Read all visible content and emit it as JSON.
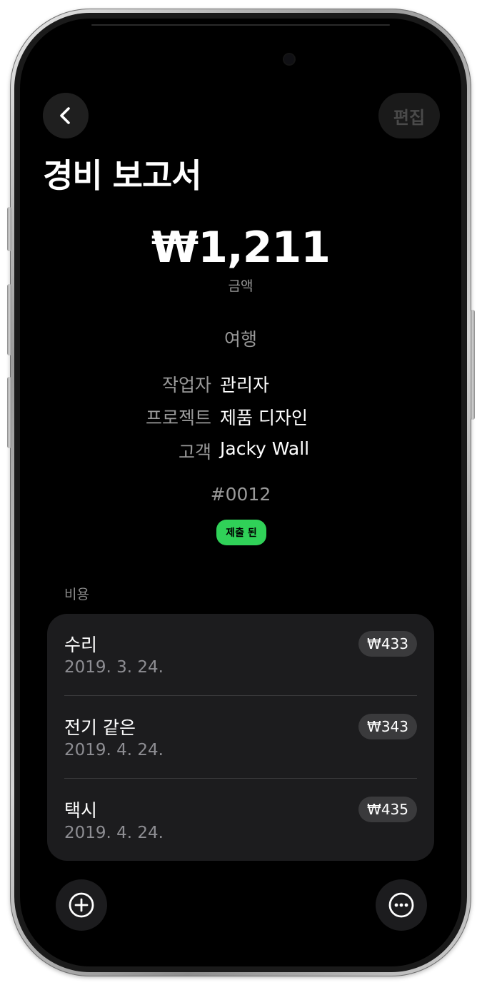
{
  "nav": {
    "back_icon": "chevron-left-icon",
    "edit_label": "편집"
  },
  "header": {
    "title": "경비 보고서"
  },
  "summary": {
    "amount": "₩1,211",
    "amount_label": "금액",
    "category": "여행"
  },
  "details": [
    {
      "key": "작업자",
      "value": "관리자"
    },
    {
      "key": "프로젝트",
      "value": "제품 디자인"
    },
    {
      "key": "고객",
      "value": "Jacky Wall"
    }
  ],
  "report": {
    "id": "#0012",
    "status": "제출 된",
    "status_color": "#30d158"
  },
  "expenses": {
    "section_label": "비용",
    "items": [
      {
        "name": "수리",
        "date": "2019. 3. 24.",
        "amount": "₩433"
      },
      {
        "name": "전기 같은",
        "date": "2019. 4. 24.",
        "amount": "₩343"
      },
      {
        "name": "택시",
        "date": "2019. 4. 24.",
        "amount": "₩435"
      }
    ]
  },
  "toolbar": {
    "add_icon": "plus-circle-icon",
    "more_icon": "ellipsis-circle-icon"
  }
}
